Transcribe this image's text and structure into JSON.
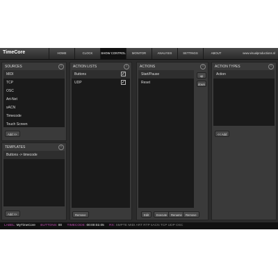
{
  "app": {
    "title": "TimeCore",
    "website": "www.visualproductions.nl"
  },
  "nav": {
    "tabs": [
      {
        "label": "HOME"
      },
      {
        "label": "CLOCK"
      },
      {
        "label": "SHOW CONTROL",
        "active": true
      },
      {
        "label": "MONITOR"
      },
      {
        "label": "ANALYSIS"
      },
      {
        "label": "SETTINGS"
      },
      {
        "label": "ABOUT"
      }
    ]
  },
  "sources": {
    "title": "SOURCES",
    "items": [
      "MIDI",
      "TCP",
      "OSC",
      "Art-Net",
      "sACN",
      "Timecode",
      "Touch Screen"
    ],
    "selected": "MIDI",
    "add_label": "Add >>"
  },
  "templates": {
    "title": "TEMPLATES",
    "items": [
      "Buttons -> timecode"
    ],
    "add_label": "Add >>"
  },
  "action_lists": {
    "title": "ACTION LISTS",
    "items": [
      {
        "label": "Buttons",
        "checked": true
      },
      {
        "label": "UDP",
        "checked": true
      }
    ],
    "remove_label": "Remove"
  },
  "actions": {
    "title": "ACTIONS",
    "items": [
      "Start/Pause",
      "Reset"
    ],
    "up_label": "up",
    "down_label": "down",
    "edit_label": "Edit",
    "execute_label": "Execute",
    "rename_label": "Rename",
    "remove_label": "Remove"
  },
  "action_types": {
    "title": "ACTION TYPES",
    "items": [
      "Action"
    ],
    "add_label": "<< Add"
  },
  "status": {
    "label_key": "LABEL:",
    "label_value": "MyTimeCore",
    "buttons_key": "BUTTONS:",
    "buttons_value": "00",
    "timecode_key": "TIMECODE:",
    "timecode_value": "00:00:02.05",
    "rx_key": "RX:",
    "rx_items": "SMPTE MIDI ART RTP sACN TCP UDP OSC"
  },
  "colors": {
    "accent": "#c24fb4",
    "background": "#2b2b2b",
    "list_bg": "#1a1a1a"
  }
}
